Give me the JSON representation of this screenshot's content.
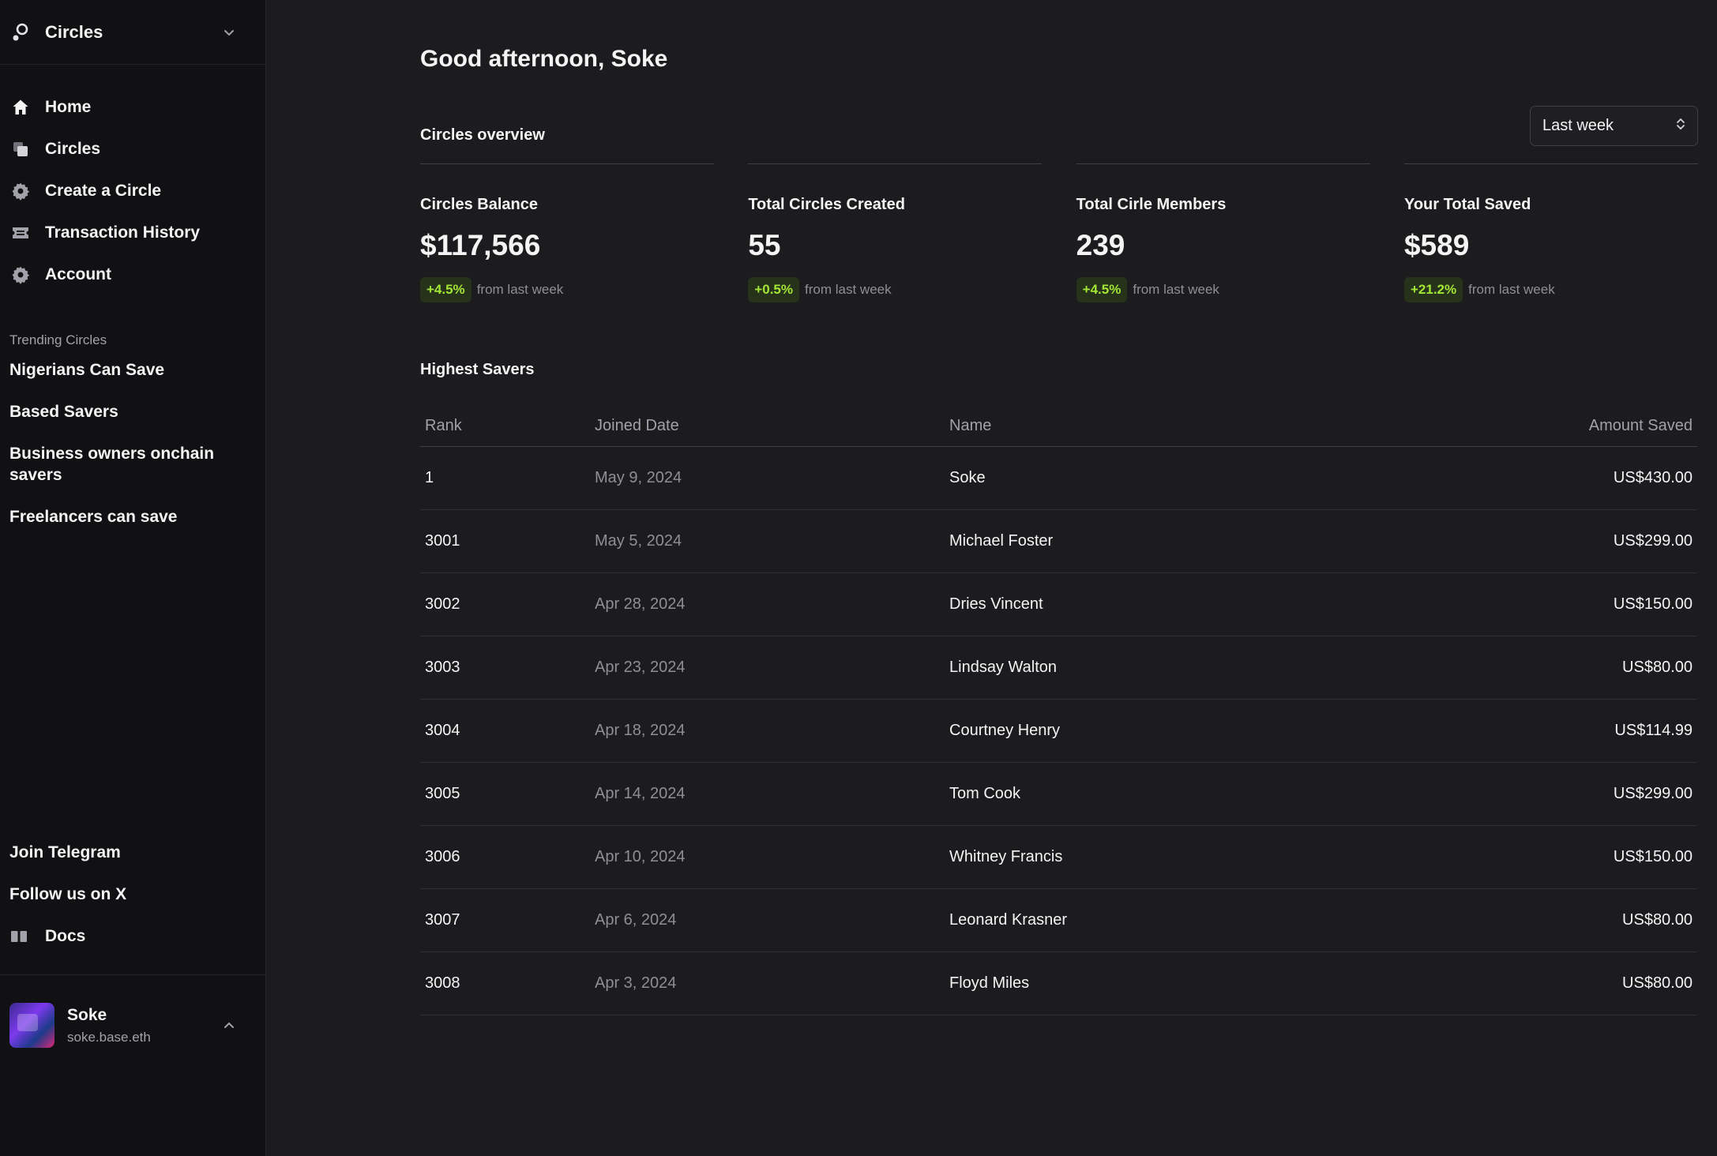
{
  "sidebar": {
    "brand": "Circles",
    "nav": [
      {
        "label": "Home",
        "icon": "home-icon"
      },
      {
        "label": "Circles",
        "icon": "stack-icon"
      },
      {
        "label": "Create a Circle",
        "icon": "gear-icon"
      },
      {
        "label": "Transaction History",
        "icon": "ticket-icon"
      },
      {
        "label": "Account",
        "icon": "gear-icon"
      }
    ],
    "trending_label": "Trending Circles",
    "trending": [
      "Nigerians Can Save",
      "Based Savers",
      "Business owners onchain savers",
      "Freelancers can save"
    ],
    "bottom_links": [
      {
        "label": "Join Telegram"
      },
      {
        "label": "Follow us on X"
      },
      {
        "label": "Docs",
        "icon": "book-icon"
      }
    ],
    "profile": {
      "name": "Soke",
      "handle": "soke.base.eth"
    }
  },
  "main": {
    "greeting": "Good afternoon, Soke",
    "overview_title": "Circles overview",
    "period": "Last week",
    "stats": [
      {
        "label": "Circles Balance",
        "value": "$117,566",
        "change": "+4.5%",
        "change_text": "from last week"
      },
      {
        "label": "Total Circles Created",
        "value": "55",
        "change": "+0.5%",
        "change_text": "from last week"
      },
      {
        "label": "Total Cirle Members",
        "value": "239",
        "change": "+4.5%",
        "change_text": "from last week"
      },
      {
        "label": "Your Total Saved",
        "value": "$589",
        "change": "+21.2%",
        "change_text": "from last week"
      }
    ],
    "savers_title": "Highest Savers",
    "table": {
      "headers": {
        "rank": "Rank",
        "date": "Joined Date",
        "name": "Name",
        "amount": "Amount Saved"
      },
      "rows": [
        {
          "rank": "1",
          "date": "May 9, 2024",
          "name": "Soke",
          "amount": "US$430.00"
        },
        {
          "rank": "3001",
          "date": "May 5, 2024",
          "name": "Michael Foster",
          "amount": "US$299.00"
        },
        {
          "rank": "3002",
          "date": "Apr 28, 2024",
          "name": "Dries Vincent",
          "amount": "US$150.00"
        },
        {
          "rank": "3003",
          "date": "Apr 23, 2024",
          "name": "Lindsay Walton",
          "amount": "US$80.00"
        },
        {
          "rank": "3004",
          "date": "Apr 18, 2024",
          "name": "Courtney Henry",
          "amount": "US$114.99"
        },
        {
          "rank": "3005",
          "date": "Apr 14, 2024",
          "name": "Tom Cook",
          "amount": "US$299.00"
        },
        {
          "rank": "3006",
          "date": "Apr 10, 2024",
          "name": "Whitney Francis",
          "amount": "US$150.00"
        },
        {
          "rank": "3007",
          "date": "Apr 6, 2024",
          "name": "Leonard Krasner",
          "amount": "US$80.00"
        },
        {
          "rank": "3008",
          "date": "Apr 3, 2024",
          "name": "Floyd Miles",
          "amount": "US$80.00"
        }
      ]
    }
  },
  "colors": {
    "accent_green": "#a3e635",
    "badge_bg": "#26321a",
    "background": "#1c1c1e",
    "sidebar_bg": "#111113"
  }
}
